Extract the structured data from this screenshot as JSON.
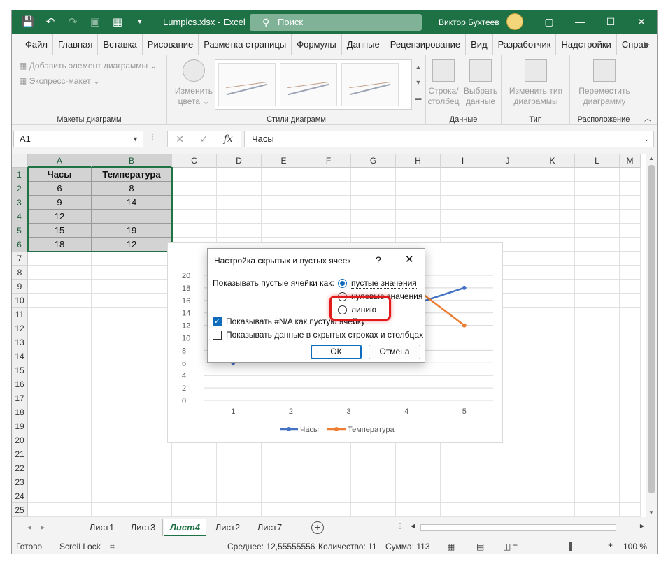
{
  "title_bar": {
    "doc_title": "Lumpics.xlsx  -  Excel",
    "search_placeholder": "Поиск",
    "user_name": "Виктор Бухтеев",
    "accent": "#1e7145"
  },
  "menu": {
    "tabs": [
      "Файл",
      "Главная",
      "Вставка",
      "Рисование",
      "Разметка страницы",
      "Формулы",
      "Данные",
      "Рецензирование",
      "Вид",
      "Разработчик",
      "Надстройки",
      "Справ"
    ]
  },
  "ribbon": {
    "add_element": "Добавить элемент диаграммы",
    "express_layout": "Экспресс-макет",
    "group_layouts": "Макеты диаграмм",
    "change_colors_1": "Изменить",
    "change_colors_2": "цвета",
    "group_styles": "Стили диаграмм",
    "row_col_1": "Строка/",
    "row_col_2": "столбец",
    "select_data_1": "Выбрать",
    "select_data_2": "данные",
    "group_data": "Данные",
    "change_type_1": "Изменить тип",
    "change_type_2": "диаграммы",
    "group_type": "Тип",
    "move_chart_1": "Переместить",
    "move_chart_2": "диаграмму",
    "group_location": "Расположение"
  },
  "formula_bar": {
    "name_box": "A1",
    "fx": "fx",
    "content": "Часы"
  },
  "grid": {
    "columns": [
      "A",
      "B",
      "C",
      "D",
      "E",
      "F",
      "G",
      "H",
      "I",
      "J",
      "K",
      "L",
      "M"
    ],
    "rows": [
      "1",
      "2",
      "3",
      "4",
      "5",
      "6",
      "7",
      "8",
      "9",
      "10",
      "11",
      "12",
      "13",
      "14",
      "15",
      "16",
      "17",
      "18",
      "19",
      "20",
      "21",
      "22",
      "23",
      "24",
      "25"
    ],
    "table": [
      [
        "Часы",
        "Температура"
      ],
      [
        "6",
        "8"
      ],
      [
        "9",
        "14"
      ],
      [
        "12",
        ""
      ],
      [
        "15",
        "19"
      ],
      [
        "18",
        "12"
      ]
    ]
  },
  "chart_data": {
    "type": "line",
    "x": [
      1,
      2,
      3,
      4,
      5
    ],
    "series": [
      {
        "name": "Часы",
        "values": [
          6,
          9,
          12,
          15,
          18
        ],
        "color": "#4472c4"
      },
      {
        "name": "Температура",
        "values": [
          8,
          14,
          null,
          19,
          12
        ],
        "color": "#ed7d31"
      }
    ],
    "ylim": [
      0,
      20
    ],
    "yticks": [
      "20",
      "18",
      "16",
      "14",
      "12",
      "10",
      "8",
      "6",
      "4",
      "2",
      "0"
    ],
    "xticks": [
      "1",
      "2",
      "3",
      "4",
      "5"
    ],
    "legend": "bottom",
    "grid": true
  },
  "dialog": {
    "title": "Настройка скрытых и пустых ячеек",
    "help": "?",
    "close": "✕",
    "show_empty_label": "Показывать пустые ячейки как:",
    "opt_gaps": "пустые значения",
    "opt_zero": "нулевые значения",
    "opt_line": "линию",
    "opt_selected": "gaps",
    "show_na": "Показывать #N/A как пустую ячейку",
    "show_na_checked": true,
    "show_hidden": "Показывать данные в скрытых строках и столбцах",
    "show_hidden_checked": false,
    "ok": "ОК",
    "cancel": "Отмена",
    "highlight_color": "#e11b1b"
  },
  "sheets": {
    "tabs": [
      "Лист1",
      "Лист3",
      "Лист4",
      "Лист2",
      "Лист7"
    ],
    "active": "Лист4",
    "add": "+"
  },
  "status": {
    "ready": "Готово",
    "scroll_lock": "Scroll Lock",
    "average": "Среднее: 12,55555556",
    "count": "Количество: 11",
    "sum": "Сумма: 113",
    "zoom": "100 %"
  }
}
